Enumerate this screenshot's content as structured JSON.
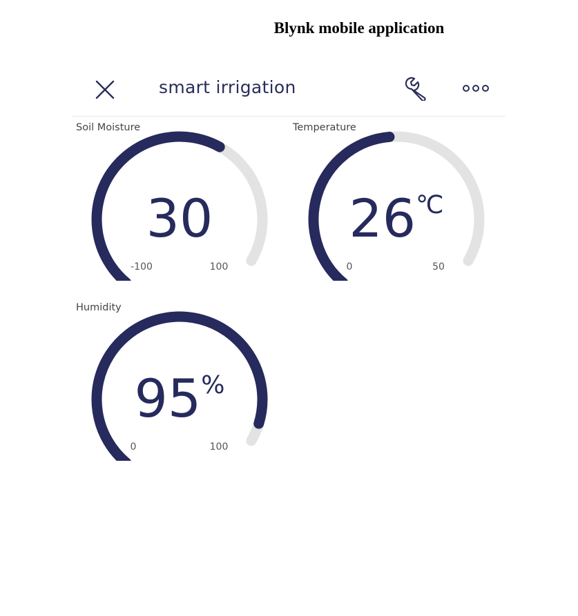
{
  "caption": "Blynk mobile application",
  "app": {
    "title": "smart irrigation"
  },
  "icons": {
    "close": "close-icon",
    "settings": "wrench-icon",
    "more": "more-options-icon"
  },
  "colors": {
    "gauge_fill": "#262a5c",
    "gauge_track": "#e3e3e3",
    "title": "#2a2d5a"
  },
  "widgets": [
    {
      "label": "Soil Moisture",
      "value": "30",
      "numeric": 30,
      "unit": "",
      "min": "-100",
      "max": "100",
      "min_num": -100,
      "max_num": 100
    },
    {
      "label": "Temperature",
      "value": "26",
      "numeric": 26,
      "unit": "℃",
      "min": "0",
      "max": "50",
      "min_num": 0,
      "max_num": 50
    },
    {
      "label": "Humidity",
      "value": "95",
      "numeric": 95,
      "unit": "%",
      "min": "0",
      "max": "100",
      "min_num": 0,
      "max_num": 100
    }
  ]
}
